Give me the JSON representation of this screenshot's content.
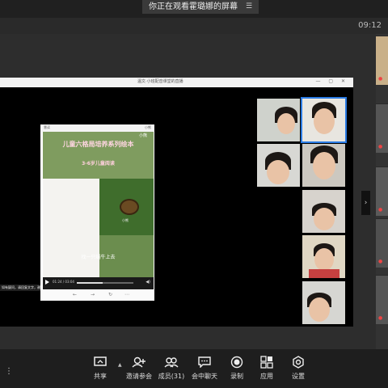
{
  "banner": {
    "text": "你正在观看霍璐娜的屏幕",
    "menu_icon": "menu-icon"
  },
  "status": {
    "time": "09:12"
  },
  "shared_window": {
    "title": "温文·小班配音课堂的直播",
    "notice": "如有疑问，请回复文字，谢谢"
  },
  "player": {
    "header_left": "慧读",
    "header_right": "小熊",
    "title": "儿童六格局培养系列绘本",
    "subtitle": "3-6岁儿童阅读",
    "logo": "小熊",
    "logo2": "小熊",
    "caption": "找一只蜗牛上去",
    "time": "01:24 / 03:04",
    "progress": 0.46
  },
  "toolbar": {
    "share": "共享",
    "invite": "邀请参会",
    "members": "成员(31)",
    "chat": "会中聊天",
    "record": "录制",
    "apps": "应用",
    "settings": "设置"
  },
  "colors": {
    "accent": "#2a7be4",
    "stage": "#2d2d2d",
    "bar": "#1e1e1e"
  }
}
